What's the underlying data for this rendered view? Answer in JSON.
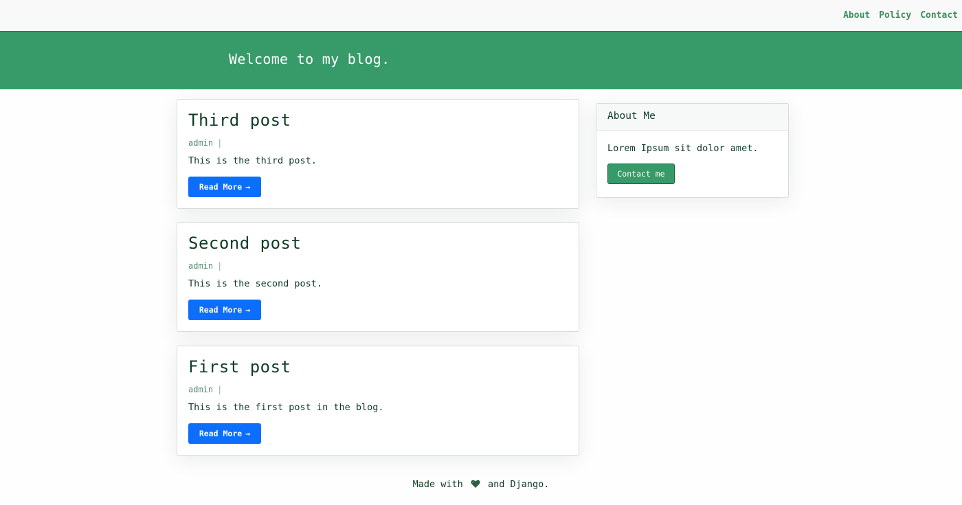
{
  "nav": {
    "links": [
      "About",
      "Policy",
      "Contact"
    ]
  },
  "hero": {
    "title": "Welcome to my blog."
  },
  "posts": [
    {
      "title": "Third post",
      "author": "admin",
      "separator": "|",
      "excerpt": "This is the third post.",
      "button_label": "Read More",
      "button_arrow": "→"
    },
    {
      "title": "Second post",
      "author": "admin",
      "separator": "|",
      "excerpt": "This is the second post.",
      "button_label": "Read More",
      "button_arrow": "→"
    },
    {
      "title": "First post",
      "author": "admin",
      "separator": "|",
      "excerpt": "This is the first post in the blog.",
      "button_label": "Read More",
      "button_arrow": "→"
    }
  ],
  "sidebar": {
    "header": "About Me",
    "text": "Lorem Ipsum sit dolor amet.",
    "button_label": "Contact me"
  },
  "footer": {
    "before_icon": "Made with",
    "icon": "heart-icon",
    "after_icon": "and Django."
  },
  "colors": {
    "brand_green": "#379b69",
    "link_green": "#3a8f5e",
    "primary_blue": "#0d6efd",
    "text_dark": "#0d3a23"
  }
}
